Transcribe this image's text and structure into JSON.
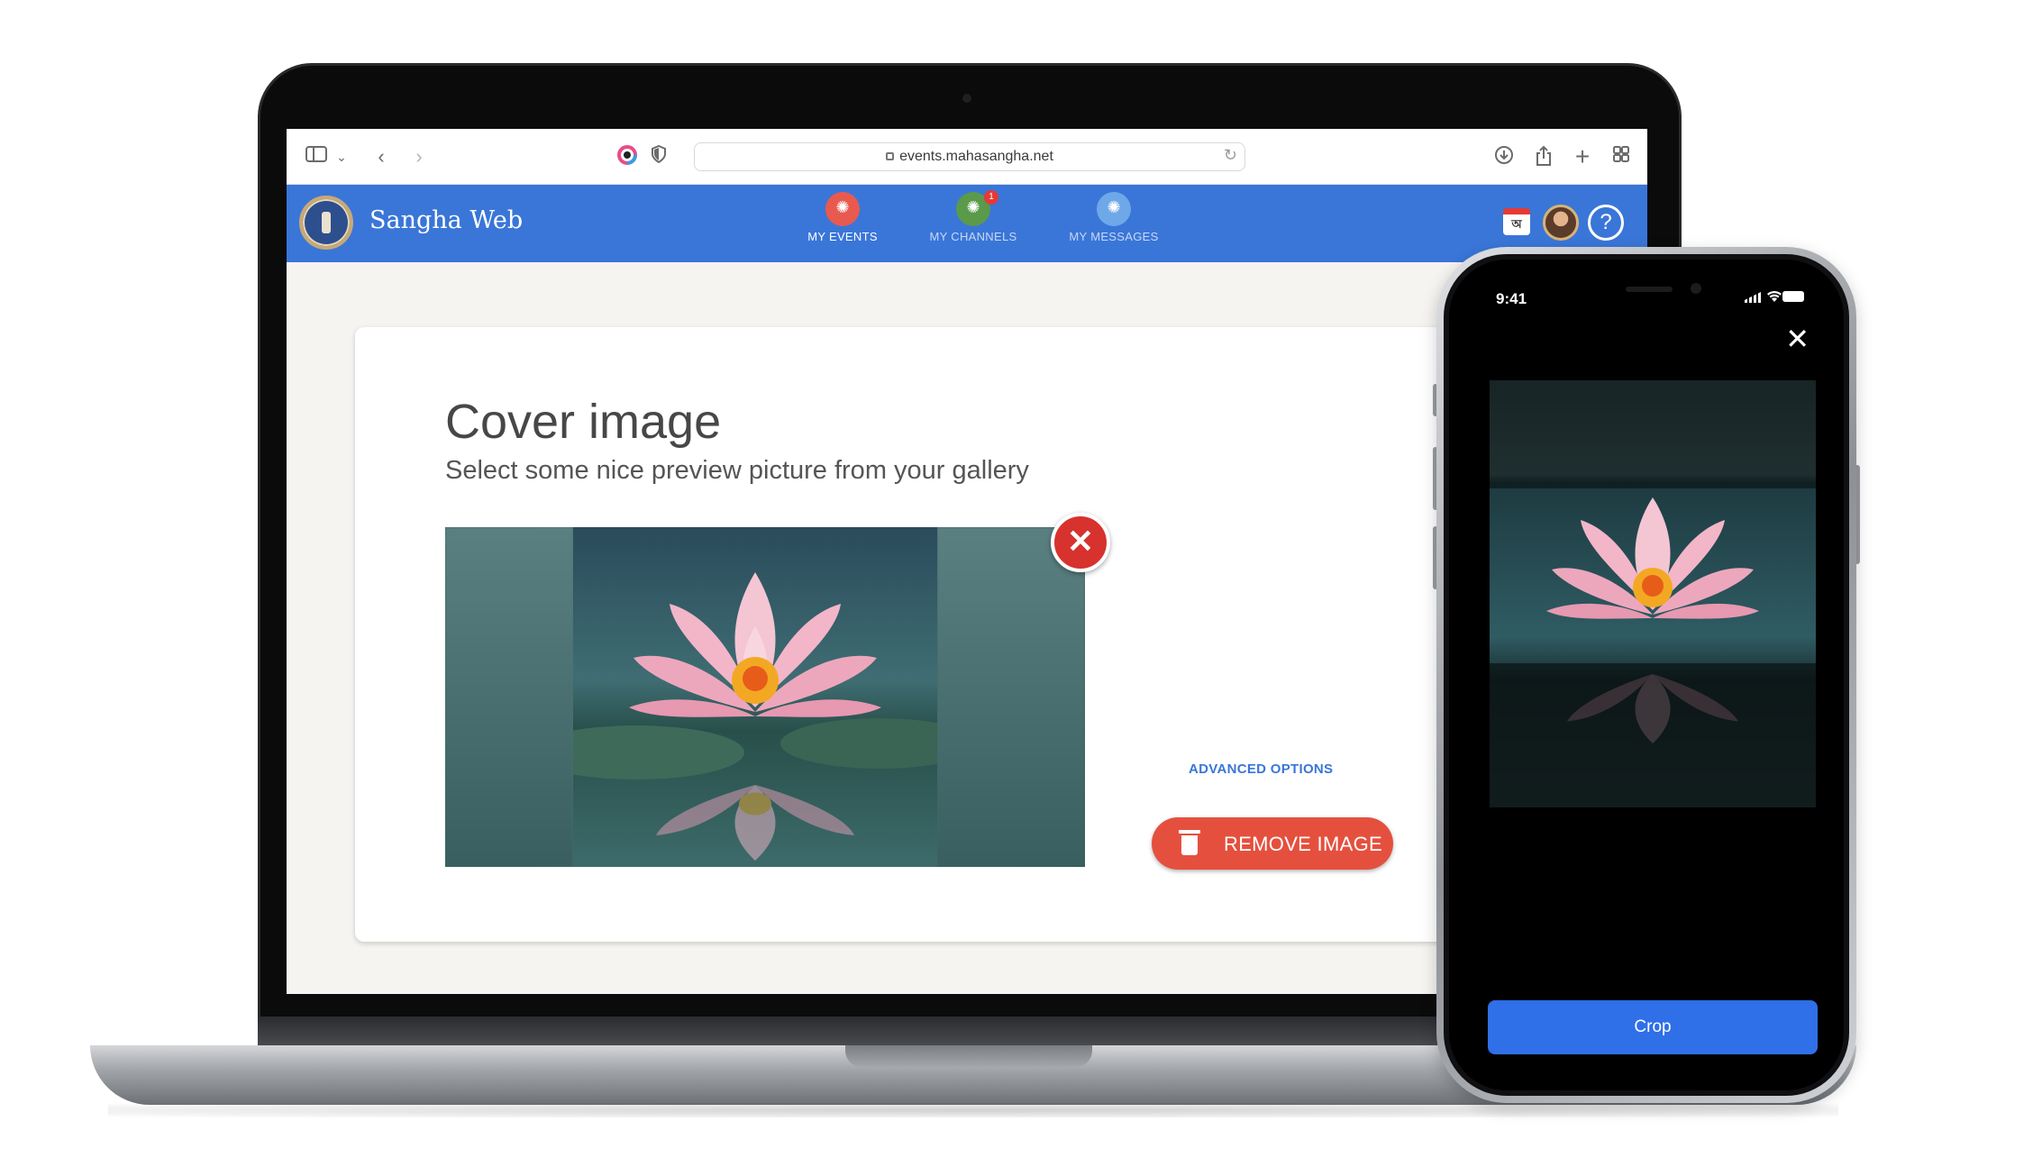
{
  "browser": {
    "url": "events.mahasangha.net"
  },
  "app": {
    "title": "Sangha Web",
    "nav": [
      {
        "label": "MY EVENTS",
        "color": "#e85a4f",
        "active": true
      },
      {
        "label": "MY CHANNELS",
        "color": "#5a9a4a",
        "badge": "1",
        "active": false
      },
      {
        "label": "MY MESSAGES",
        "color": "#6fa8e8",
        "active": false
      }
    ],
    "calendar_glyph": "অ"
  },
  "cover": {
    "title": "Cover image",
    "subtitle": "Select some nice preview picture from your gallery",
    "advanced_options": "ADVANCED OPTIONS",
    "remove_image": "REMOVE IMAGE"
  },
  "phone": {
    "time": "9:41",
    "crop_label": "Crop"
  },
  "colors": {
    "header_blue": "#3a76d8",
    "remove_red": "#e5503e",
    "crop_blue": "#2f6fe8"
  }
}
